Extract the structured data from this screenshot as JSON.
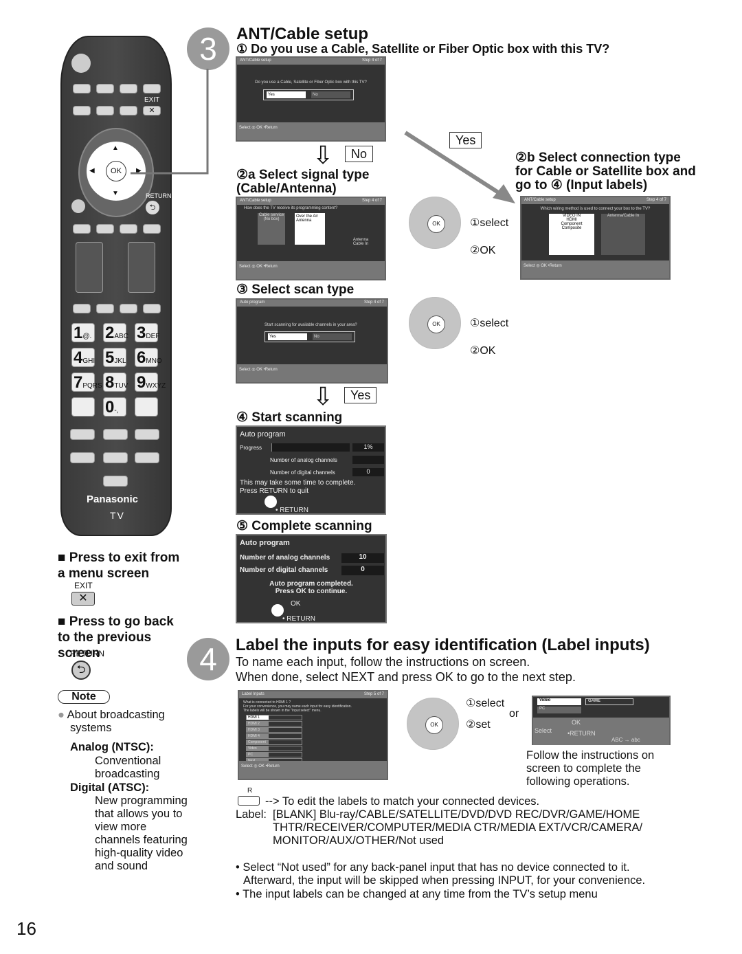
{
  "remote": {
    "exit": "EXIT",
    "ok": "OK",
    "return": "RETURN",
    "brand": "Panasonic",
    "tv": "TV",
    "keys": [
      {
        "d": "1",
        "l": "@."
      },
      {
        "d": "2",
        "l": "ABC"
      },
      {
        "d": "3",
        "l": "DEF"
      },
      {
        "d": "4",
        "l": "GHI"
      },
      {
        "d": "5",
        "l": "JKL"
      },
      {
        "d": "6",
        "l": "MNO"
      },
      {
        "d": "7",
        "l": "PQRS"
      },
      {
        "d": "8",
        "l": "TUV"
      },
      {
        "d": "9",
        "l": "WXYZ"
      },
      {
        "d": "0",
        "l": "-,"
      }
    ]
  },
  "side": {
    "exit_title": "Press to exit from a menu screen",
    "exit_label": "EXIT",
    "back_title": "Press to go back to the previous screen",
    "back_label": "RETURN",
    "note": "Note",
    "bullet": "About broadcasting systems",
    "analog_h": "Analog (NTSC):",
    "analog_t": "Conventional broadcasting",
    "digital_h": "Digital (ATSC):",
    "digital_t": "New programming that allows you to view more channels featuring high-quality video and sound"
  },
  "step3": {
    "num": "3",
    "title": "ANT/Cable setup",
    "q1": "① Do you use a Cable, Satellite or Fiber Optic box with this TV?",
    "s2a": "②a Select signal type (Cable/Antenna)",
    "s2b": "②b Select connection type for Cable or Satellite box and go to ④ (Input labels)",
    "s3": "③ Select scan type",
    "s4": "④ Start scanning",
    "s5": "⑤ Complete scanning",
    "no": "No",
    "yes": "Yes",
    "yes2": "Yes",
    "select": "①select",
    "ok": "②OK"
  },
  "screens": {
    "ant": "ANT/Cable setup",
    "step": "Step 4 of 7",
    "q_cable": "Do you use a Cable, Satellite or Fiber Optic box with this TV?",
    "yes": "Yes",
    "no": "No",
    "sel": "Select",
    "okl": "OK",
    "ret": "•Return",
    "q_signal": "How does the TV receive its programming content?",
    "cable_service": "Cable service (No box)",
    "ota": "Over the Air Antenna",
    "antenna_in": "Antenna Cable In",
    "q_wiring": "Which wiring method is used to connect your box to the TV?",
    "video_in": "VIDEO IN",
    "ant_cable_in": "Antenna/Cable In",
    "hdmi": "HDMI",
    "component": "Component",
    "composite": "Composite",
    "auto": "Auto program",
    "q_scan": "Start scanning for available channels in your area?"
  },
  "scan": {
    "title": "Auto program",
    "progress": "Progress",
    "progress_value": 1,
    "pct": "1%",
    "analog": "Number of analog channels",
    "analog_v": "",
    "digital": "Number of digital channels",
    "digital_v": "0",
    "note1": "This may take some time to complete.",
    "note2": "Press RETURN to quit",
    "ret": "RETURN"
  },
  "done": {
    "title": "Auto program",
    "analog": "Number of analog channels",
    "analog_v": "10",
    "digital": "Number of digital channels",
    "digital_v": "0",
    "msg1": "Auto program completed.",
    "msg2": "Press OK to continue.",
    "ok": "OK",
    "ret": "RETURN"
  },
  "step4": {
    "num": "4",
    "title": "Label the inputs for easy identification (Label inputs)",
    "l1": "To name each input, follow the instructions on screen.",
    "l2": "When done, select NEXT and press OK to go to the next step.",
    "scr_title": "Label Inputs",
    "scr_step": "Step 5 of 7",
    "scr_q": "What is connected to HDMI 1 ?",
    "scr_t1": "For your convenience, you may name each input for easy identification.",
    "scr_t2": "The labels will be shown in the \"Input select\" menu.",
    "inputs": [
      "HDMI 1",
      "HDMI 2",
      "HDMI 3",
      "HDMI 4",
      "Component",
      "Video",
      "PC",
      "Next"
    ],
    "select": "①select",
    "set": "②set",
    "or": "or",
    "alt_video": "Video",
    "alt_game": "GAME",
    "alt_pc": "PC",
    "alt_sel": "Select",
    "alt_ok": "OK",
    "alt_ret": "•RETURN",
    "alt_abc": "ABC → abc",
    "follow": "Follow the instructions on screen to complete the following operations.",
    "r": "R",
    "edit": "--> To edit the labels to match your connected devices.",
    "label_h": "Label:",
    "labels": "[BLANK] Blu-ray/CABLE/SATELLITE/DVD/DVD REC/DVR/GAME/HOME THTR/RECEIVER/COMPUTER/MEDIA CTR/MEDIA EXT/VCR/CAMERA/ MONITOR/AUX/OTHER/Not used",
    "b1": "• Select “Not used” for any back-panel input that has no device connected to it. Afterward, the input will be skipped when pressing INPUT, for your convenience.",
    "b2": "• The input labels can be changed at any time from the TV’s setup menu"
  },
  "page_number": "16"
}
